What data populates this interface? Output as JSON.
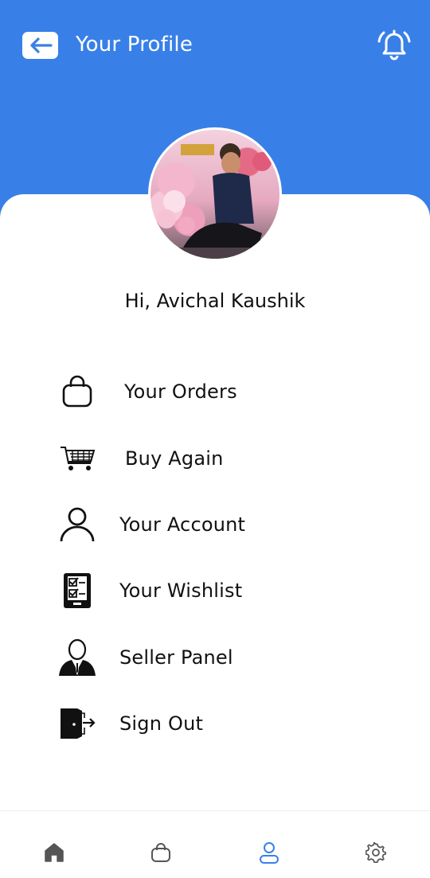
{
  "header": {
    "title": "Your Profile",
    "back_icon": "arrow-left-icon",
    "notification_icon": "bell-icon",
    "background_color": "#3880e8"
  },
  "profile": {
    "greeting": "Hi, Avichal Kaushik"
  },
  "menu": [
    {
      "label": "Your Orders",
      "icon": "shopping-bag-icon"
    },
    {
      "label": "Buy Again",
      "icon": "shopping-cart-icon"
    },
    {
      "label": "Your Account",
      "icon": "user-icon"
    },
    {
      "label": "Your Wishlist",
      "icon": "checklist-icon"
    },
    {
      "label": "Seller Panel",
      "icon": "businessman-icon"
    },
    {
      "label": "Sign Out",
      "icon": "exit-door-icon"
    }
  ],
  "bottom_nav": [
    {
      "name": "home",
      "icon": "home-icon",
      "active": false
    },
    {
      "name": "bag",
      "icon": "shopping-bag-icon",
      "active": false
    },
    {
      "name": "profile",
      "icon": "user-icon",
      "active": true
    },
    {
      "name": "settings",
      "icon": "gear-icon",
      "active": false
    }
  ],
  "colors": {
    "accent": "#3880e8",
    "active_nav": "#3880e8",
    "inactive_nav": "#555555"
  }
}
